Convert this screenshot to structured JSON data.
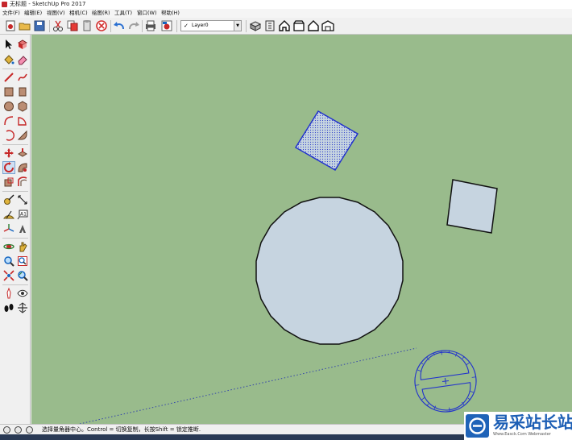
{
  "window": {
    "title": "无标题 - SketchUp Pro 2017"
  },
  "menu": [
    "文件(F)",
    "编辑(E)",
    "视图(V)",
    "相机(C)",
    "绘图(R)",
    "工具(T)",
    "窗口(W)",
    "帮助(H)"
  ],
  "layer": {
    "current": "Layer0"
  },
  "status": {
    "hint": "选择量角器中心。Control = 切换复制，长按Shift = 锁定推断."
  },
  "watermark": {
    "brand": "易采站长站",
    "url": "Www.Easck.Com  Webmaster"
  },
  "colors": {
    "viewport_background": "#99bb8c",
    "face_fill": "#c6d4e0",
    "edge": "#111111",
    "selection": "#2233cc",
    "brand": "#1d5fb5"
  },
  "icons": {
    "toolbar": [
      "new-icon",
      "open-icon",
      "save-icon",
      "cut-icon",
      "copy-icon",
      "paste-icon",
      "erase-icon",
      "undo-icon",
      "redo-icon",
      "print-icon",
      "model-info-icon",
      "component-icon",
      "package-icon",
      "home-icon",
      "box-icon",
      "house-icon",
      "warehouse-icon"
    ],
    "tools": [
      "select-icon",
      "make-component-icon",
      "paint-bucket-icon",
      "eraser-icon",
      "line-icon",
      "freehand-icon",
      "rectangle-icon",
      "rotated-rectangle-icon",
      "circle-icon",
      "polygon-icon",
      "arc-icon",
      "pie-icon",
      "two-point-arc-icon",
      "three-point-arc-icon",
      "move-icon",
      "push-pull-icon",
      "rotate-icon",
      "follow-me-icon",
      "scale-icon",
      "offset-icon",
      "tape-measure-icon",
      "dimension-icon",
      "protractor-icon",
      "text-icon",
      "axes-icon",
      "3d-text-icon",
      "orbit-icon",
      "pan-icon",
      "zoom-icon",
      "zoom-window-icon",
      "zoom-extents-icon",
      "previous-view-icon",
      "position-camera-icon",
      "look-around-icon",
      "walk-icon",
      "section-plane-icon"
    ]
  }
}
